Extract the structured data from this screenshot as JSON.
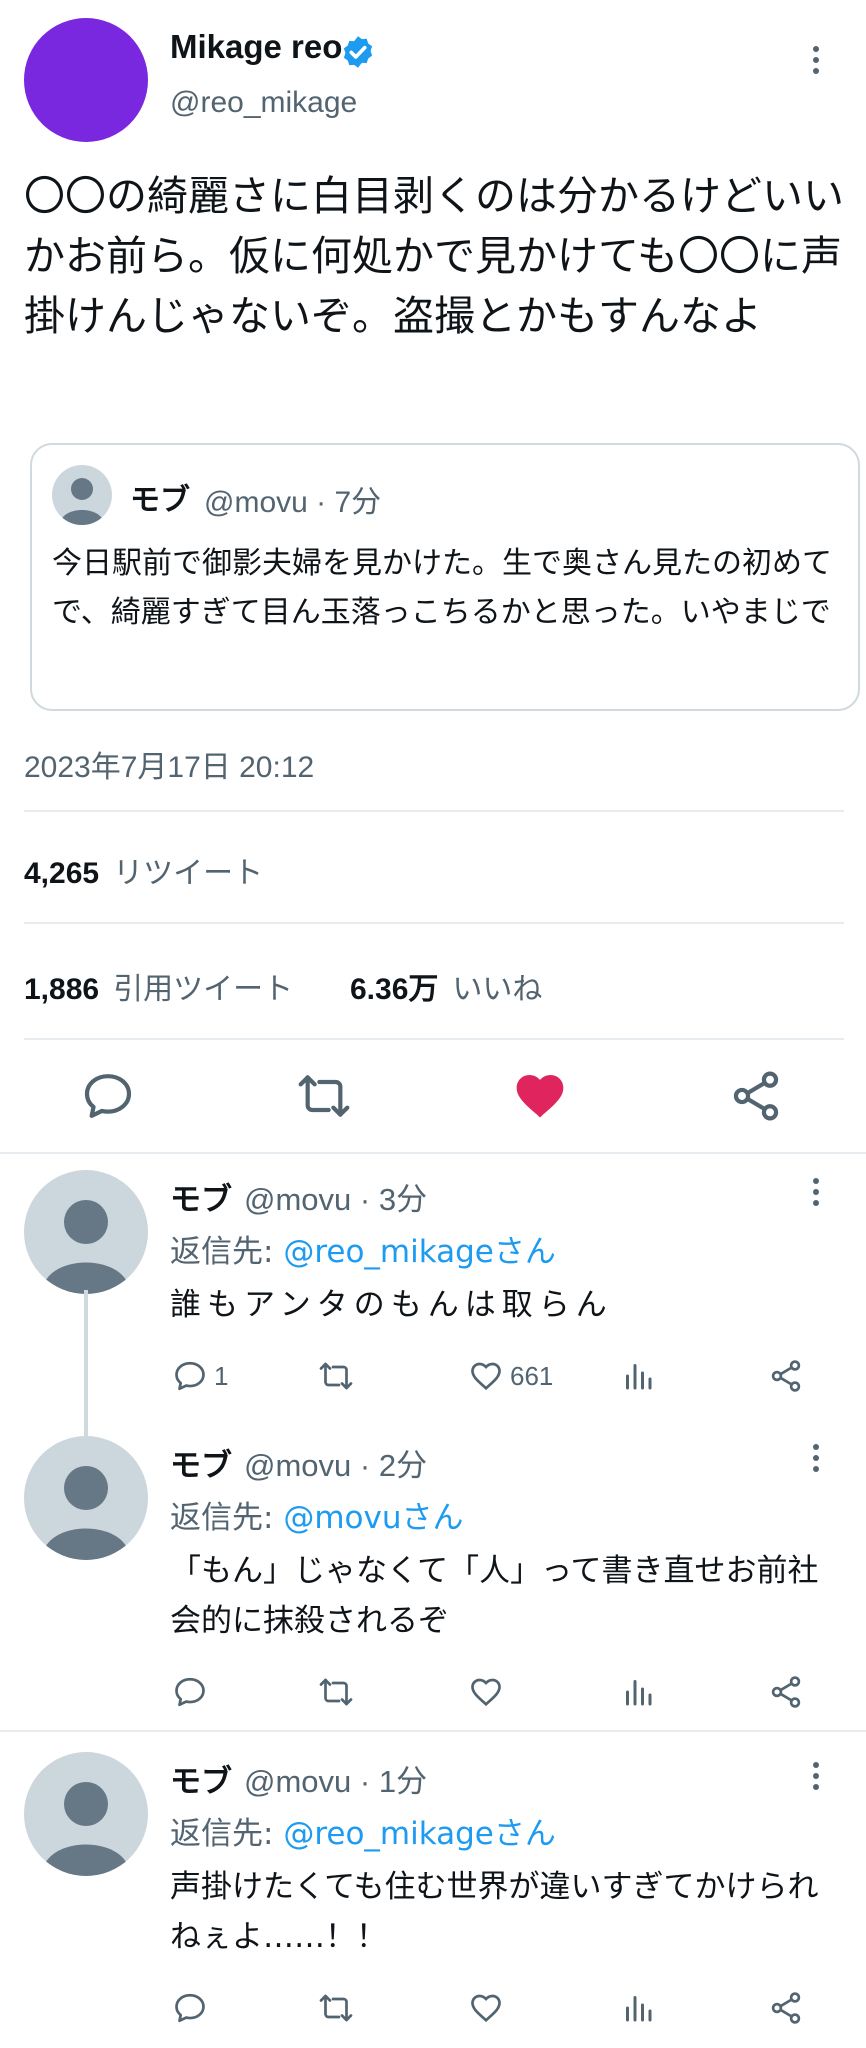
{
  "tweet": {
    "author_name": "Mikage reo",
    "author_handle": "@reo_mikage",
    "text": "〇〇の綺麗さに白目剥くのは分かるけどいいかお前ら。仮に何処かで見かけても〇〇に声掛けんじゃないぞ。盗撮とかもすんなよ",
    "timestamp": "2023年7月17日 20:12",
    "quote": {
      "name": "モブ",
      "handle": "@movu · 7分",
      "text": "今日駅前で御影夫婦を見かけた。生で奥さん見たの初めてで、綺麗すぎて目ん玉落っこちるかと思った。いやまじで"
    },
    "stats": {
      "retweets_count": "4,265",
      "retweets_label": "リツイート",
      "quotes_count": "1,886",
      "quotes_label": "引用ツイート",
      "likes_count": "6.36万",
      "likes_label": "いいね"
    },
    "colors": {
      "like_active": "#e0245e",
      "link": "#1d9bf0",
      "avatar": "#7a27e0",
      "verified": "#1d9bf0"
    }
  },
  "replies": [
    {
      "name": "モブ",
      "handle": "@movu · 3分",
      "reply_prefix": "返信先: ",
      "reply_to": "@reo_mikageさん",
      "text": "誰もアンタのもんは取らん",
      "reply_count": "1",
      "like_count": "661"
    },
    {
      "name": "モブ",
      "handle": "@movu · 2分",
      "reply_prefix": "返信先: ",
      "reply_to": "@movuさん",
      "text": "「もん」じゃなくて「人」って書き直せお前社会的に抹殺されるぞ",
      "reply_count": "",
      "like_count": ""
    },
    {
      "name": "モブ",
      "handle": "@movu · 1分",
      "reply_prefix": "返信先: ",
      "reply_to": "@reo_mikageさん",
      "text": "声掛けたくても住む世界が違いすぎてかけられねぇよ……！！",
      "reply_count": "",
      "like_count": ""
    }
  ]
}
